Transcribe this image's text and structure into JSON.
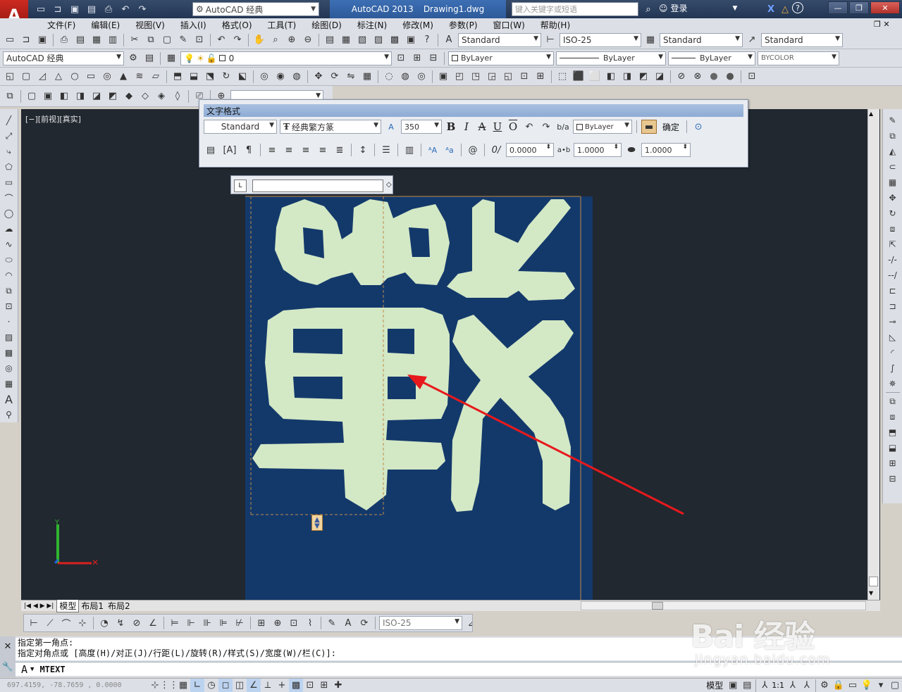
{
  "title_bar": {
    "workspace": "AutoCAD 经典",
    "app_name": "AutoCAD 2013",
    "document": "Drawing1.dwg",
    "search_placeholder": "键入关键字或短语",
    "login": "登录"
  },
  "menu": [
    "文件(F)",
    "编辑(E)",
    "视图(V)",
    "插入(I)",
    "格式(O)",
    "工具(T)",
    "绘图(D)",
    "标注(N)",
    "修改(M)",
    "参数(P)",
    "窗口(W)",
    "帮助(H)"
  ],
  "styles_toolbar": {
    "text_style": "Standard",
    "dim_style": "ISO-25",
    "table_style": "Standard",
    "mleader_style": "Standard"
  },
  "layers_toolbar": {
    "workspace": "AutoCAD 经典",
    "layer": "0",
    "color": "ByLayer",
    "linetype": "ByLayer",
    "lineweight": "ByLayer",
    "plotstyle": "BYCOLOR"
  },
  "viewport_label": "[−][前视][真实]",
  "text_format": {
    "title": "文字格式",
    "style": "Standard",
    "font": "经典繁方篆",
    "height": "350",
    "color": "ByLayer",
    "ok": "确定",
    "oblique": "0.0000",
    "tracking": "1.0000",
    "width_factor": "1.0000",
    "ruler_tab": "L",
    "bold": "B",
    "italic": "I",
    "strike": "A",
    "underline": "U",
    "overline": "O"
  },
  "tabs": [
    "模型",
    "布局1",
    "布局2"
  ],
  "dim_toolbar": {
    "dim_style": "ISO-25"
  },
  "command_line": {
    "history": [
      "指定第一角点:",
      "指定对角点或 [高度(H)/对正(J)/行距(L)/旋转(R)/样式(S)/宽度(W)/栏(C)]:"
    ],
    "current": "MTEXT",
    "prefix": "A"
  },
  "status_bar": {
    "coords": "697.4159, -78.7659 , 0.0000",
    "model": "模型",
    "scale": "1:1"
  },
  "watermark": {
    "main": "Bai 经验",
    "sub": "jingyan.baidu.com"
  },
  "colors": {
    "canvas": "#212830",
    "paper": "#13396b",
    "glyph": "#d3e8c5",
    "arrow": "#e8191c"
  }
}
